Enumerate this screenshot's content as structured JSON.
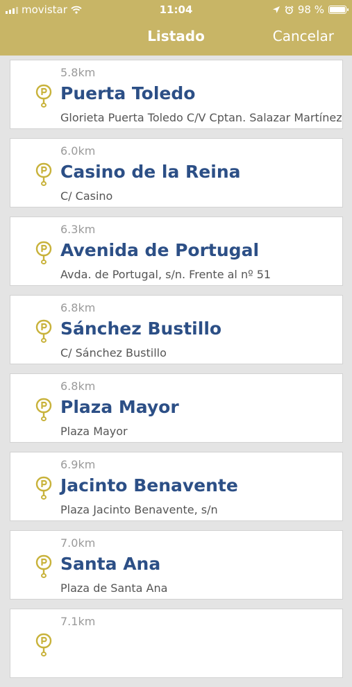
{
  "status_bar": {
    "carrier": "movistar",
    "time": "11:04",
    "battery_text": "98 %",
    "battery_level": 0.98
  },
  "nav": {
    "title": "Listado",
    "cancel_label": "Cancelar"
  },
  "colors": {
    "header": "#c8b566",
    "title_blue": "#2c4f86",
    "pin_gold": "#c8b23a"
  },
  "icons": {
    "list_item": "parking-pin-icon"
  },
  "items": [
    {
      "distance": "5.8km",
      "name": "Puerta Toledo",
      "address": "Glorieta Puerta Toledo C/V Cptan. Salazar Martínez"
    },
    {
      "distance": "6.0km",
      "name": "Casino de la Reina",
      "address": "C/ Casino"
    },
    {
      "distance": "6.3km",
      "name": "Avenida de Portugal",
      "address": "Avda. de Portugal, s/n. Frente al nº 51"
    },
    {
      "distance": "6.8km",
      "name": "Sánchez Bustillo",
      "address": "C/ Sánchez Bustillo"
    },
    {
      "distance": "6.8km",
      "name": "Plaza Mayor",
      "address": "Plaza Mayor"
    },
    {
      "distance": "6.9km",
      "name": "Jacinto Benavente",
      "address": "Plaza Jacinto Benavente, s/n"
    },
    {
      "distance": "7.0km",
      "name": "Santa Ana",
      "address": "Plaza de Santa Ana"
    },
    {
      "distance": "7.1km",
      "name": "",
      "address": ""
    }
  ]
}
